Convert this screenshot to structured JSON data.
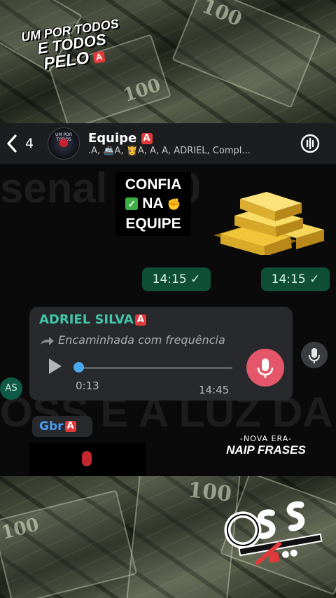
{
  "background_logo": {
    "line1": "UM POR TODOS",
    "line2": "E TODOS",
    "line3": "PELO",
    "badge": "A"
  },
  "header": {
    "back_count": "4",
    "group_name": "Equipe",
    "group_badge": "A",
    "members": ".A, 🚢A, 👸A, A, A, ADRIEL, Compl...",
    "avatar_text": "UM POR TODOS"
  },
  "chat": {
    "sticker_text": {
      "line1": "CONFIA",
      "line2": "NA",
      "line3": "EQUIPE"
    },
    "time_bubbles": [
      {
        "time": "14:15 ✓"
      },
      {
        "time": "14:15 ✓"
      }
    ],
    "voice_message": {
      "sender": "ADRIEL SILVA",
      "sender_badge": "A",
      "forwarded_label": "Encaminhada com frequência",
      "duration": "0:13",
      "time": "14:45",
      "progress": 0.0
    },
    "sender_avatar": "AS",
    "gbr_message": {
      "sender": "Gbr",
      "badge": "A"
    },
    "watermark": {
      "subtitle": "-NOVA ERA-",
      "title": "NAIP FRASES"
    }
  },
  "colors": {
    "header_bg": "#1c1d1f",
    "outgoing_bubble": "#0e4f36",
    "incoming_bubble": "#27292c",
    "sender_green": "#42c4a6",
    "sender_blue": "#4a9cf0",
    "mic_red": "#e4566a",
    "badge_red": "#e23a3a"
  },
  "icons": {
    "back": "chevron-left-icon",
    "call": "voice-call-icon",
    "forward": "forward-arrow-icon",
    "play": "play-icon",
    "mic": "microphone-icon"
  }
}
